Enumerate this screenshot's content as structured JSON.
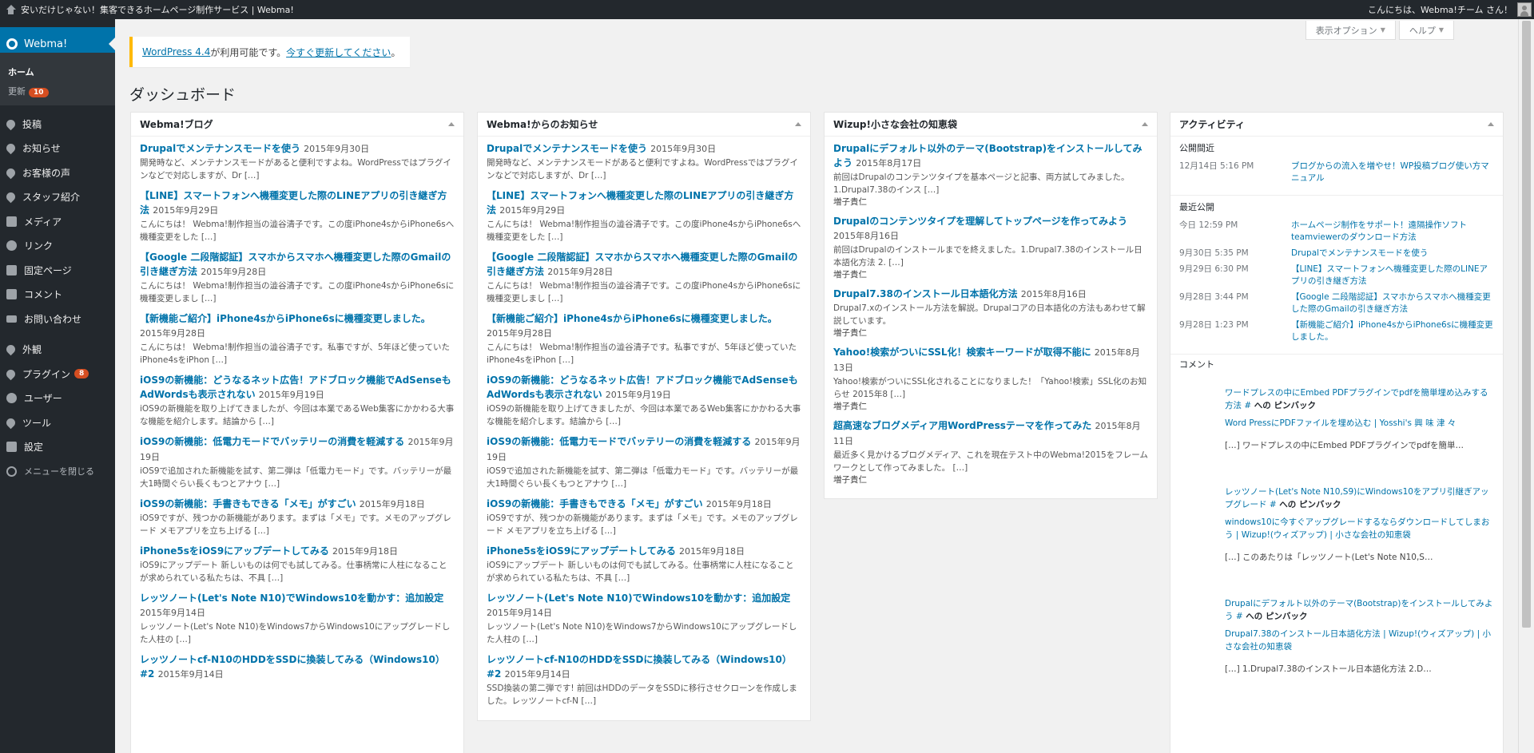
{
  "adminbar": {
    "site_title": "安いだけじゃない！集客できるホームページ制作サービス | Webma!",
    "greeting": "こんにちは、Webma!チーム さん！"
  },
  "sidebar": {
    "brand": "Webma!",
    "home": "ホーム",
    "updates": "更新",
    "updates_count": "10",
    "items": [
      {
        "label": "投稿",
        "icon": "pin-icon"
      },
      {
        "label": "お知らせ",
        "icon": "pin-icon"
      },
      {
        "label": "お客様の声",
        "icon": "pin-icon"
      },
      {
        "label": "スタッフ紹介",
        "icon": "pin-icon"
      },
      {
        "label": "メディア",
        "icon": "media-icon"
      },
      {
        "label": "リンク",
        "icon": "link-icon"
      },
      {
        "label": "固定ページ",
        "icon": "page-icon"
      },
      {
        "label": "コメント",
        "icon": "comment-icon"
      },
      {
        "label": "お問い合わせ",
        "icon": "envelope-icon"
      },
      {
        "label": "外観",
        "icon": "brush-icon"
      },
      {
        "label": "プラグイン",
        "icon": "plugin-icon",
        "badge": "8"
      },
      {
        "label": "ユーザー",
        "icon": "user-icon"
      },
      {
        "label": "ツール",
        "icon": "wrench-icon"
      },
      {
        "label": "設定",
        "icon": "settings-icon"
      }
    ],
    "collapse": "メニューを閉じる"
  },
  "screen_tabs": {
    "options": "表示オプション",
    "help": "ヘルプ"
  },
  "notice": {
    "link1": "WordPress 4.4",
    "text": " が利用可能です。",
    "link2": "今すぐ更新してください",
    "end": "。"
  },
  "page_title": "ダッシュボード",
  "col1": {
    "title": "Webma!ブログ",
    "posts": [
      {
        "title": "Drupalでメンテナンスモードを使う",
        "date": "2015年9月30日",
        "excerpt": "開発時など、メンテナンスモードがあると便利ですよね。WordPressではプラグインなどで対応しますが、Dr […]"
      },
      {
        "title": "【LINE】スマートフォンへ機種変更した際のLINEアプリの引き継ぎ方法",
        "date": "2015年9月29日",
        "excerpt": "こんにちは！ Webma!制作担当の澁谷清子です。この度iPhone4sからiPhone6sへ機種変更をした […]"
      },
      {
        "title": "【Google 二段階認証】スマホからスマホへ機種変更した際のGmailの引き継ぎ方法",
        "date": "2015年9月28日",
        "excerpt": "こんにちは！ Webma!制作担当の澁谷清子です。この度iPhone4sからiPhone6sに機種変更しまし […]"
      },
      {
        "title": "【新機能ご紹介】iPhone4sからiPhone6sに機種変更しました。",
        "date": "2015年9月28日",
        "excerpt": "こんにちは！ Webma!制作担当の澁谷清子です。私事ですが、5年ほど使っていたiPhone4sをiPhon […]"
      },
      {
        "title": "iOS9の新機能：どうなるネット広告！アドブロック機能でAdSenseもAdWordsも表示されない",
        "date": "2015年9月19日",
        "excerpt": "iOS9の新機能を取り上げてきましたが、今回は本業であるWeb集客にかかわる大事な機能を紹介します。結論から […]"
      },
      {
        "title": "iOS9の新機能：低電力モードでバッテリーの消費を軽減する",
        "date": "2015年9月19日",
        "excerpt": "iOS9で追加された新機能を試す、第二弾は「低電力モード」です。バッテリーが最大1時間ぐらい長くもつとアナウ […]"
      },
      {
        "title": "iOS9の新機能：手書きもできる「メモ」がすごい",
        "date": "2015年9月18日",
        "excerpt": "iOS9ですが、残つかの新機能があります。まずは「メモ」です。メモのアップグレード メモアプリを立ち上げる […]"
      },
      {
        "title": "iPhone5sをiOS9にアップデートしてみる",
        "date": "2015年9月18日",
        "excerpt": "iOS9にアップデート 新しいものは何でも試してみる。仕事柄常に人柱になることが求められている私たちは、不具 […]"
      },
      {
        "title": "レッツノート(Let's Note N10)でWindows10を動かす：追加設定",
        "date": "2015年9月14日",
        "excerpt": "レッツノート(Let's Note N10)をWindows7からWindows10にアップグレードした人柱の […]"
      },
      {
        "title": "レッツノートcf-N10のHDDをSSDに換装してみる（Windows10）#2",
        "date": "2015年9月14日",
        "excerpt": ""
      }
    ]
  },
  "col2": {
    "title": "Webma!からのお知らせ",
    "posts": [
      {
        "title": "Drupalでメンテナンスモードを使う",
        "date": "2015年9月30日",
        "excerpt": "開発時など、メンテナンスモードがあると便利ですよね。WordPressではプラグインなどで対応しますが、Dr […]"
      },
      {
        "title": "【LINE】スマートフォンへ機種変更した際のLINEアプリの引き継ぎ方法",
        "date": "2015年9月29日",
        "excerpt": "こんにちは！ Webma!制作担当の澁谷清子です。この度iPhone4sからiPhone6sへ機種変更をした […]"
      },
      {
        "title": "【Google 二段階認証】スマホからスマホへ機種変更した際のGmailの引き継ぎ方法",
        "date": "2015年9月28日",
        "excerpt": "こんにちは！ Webma!制作担当の澁谷清子です。この度iPhone4sからiPhone6sに機種変更しまし […]"
      },
      {
        "title": "【新機能ご紹介】iPhone4sからiPhone6sに機種変更しました。",
        "date": "2015年9月28日",
        "excerpt": "こんにちは！ Webma!制作担当の澁谷清子です。私事ですが、5年ほど使っていたiPhone4sをiPhon […]"
      },
      {
        "title": "iOS9の新機能：どうなるネット広告！アドブロック機能でAdSenseもAdWordsも表示されない",
        "date": "2015年9月19日",
        "excerpt": "iOS9の新機能を取り上げてきましたが、今回は本業であるWeb集客にかかわる大事な機能を紹介します。結論から […]"
      },
      {
        "title": "iOS9の新機能：低電力モードでバッテリーの消費を軽減する",
        "date": "2015年9月19日",
        "excerpt": "iOS9で追加された新機能を試す、第二弾は「低電力モード」です。バッテリーが最大1時間ぐらい長くもつとアナウ […]"
      },
      {
        "title": "iOS9の新機能：手書きもできる「メモ」がすごい",
        "date": "2015年9月18日",
        "excerpt": "iOS9ですが、残つかの新機能があります。まずは「メモ」です。メモのアップグレード メモアプリを立ち上げる […]"
      },
      {
        "title": "iPhone5sをiOS9にアップデートしてみる",
        "date": "2015年9月18日",
        "excerpt": "iOS9にアップデート 新しいものは何でも試してみる。仕事柄常に人柱になることが求められている私たちは、不具 […]"
      },
      {
        "title": "レッツノート(Let's Note N10)でWindows10を動かす：追加設定",
        "date": "2015年9月14日",
        "excerpt": "レッツノート(Let's Note N10)をWindows7からWindows10にアップグレードした人柱の […]"
      },
      {
        "title": "レッツノートcf-N10のHDDをSSDに換装してみる（Windows10）#2",
        "date": "2015年9月14日",
        "excerpt": "SSD換装の第二弾です! 前回はHDDのデータをSSDに移行させクローンを作成しました。レッツノートcf-N […]"
      }
    ]
  },
  "col3": {
    "title": "Wizup!小さな会社の知恵袋",
    "posts": [
      {
        "title": "Drupalにデフォルト以外のテーマ(Bootstrap)をインストールしてみよう",
        "date": "2015年8月17日",
        "excerpt": "前回はDrupalのコンテンツタイプを基本ページと記事、両方試してみました。1.Drupal7.38のインス […]",
        "author": "増子貴仁"
      },
      {
        "title": "Drupalのコンテンツタイプを理解してトップページを作ってみよう",
        "date": "2015年8月16日",
        "excerpt": "前回はDrupalのインストールまでを終えました。1.Drupal7.38のインストール日本語化方法 2. […]",
        "author": "増子貴仁"
      },
      {
        "title": "Drupal7.38のインストール日本語化方法",
        "date": "2015年8月16日",
        "excerpt": "Drupal7.xのインストール方法を解説。Drupalコアの日本語化の方法もあわせて解説しています。",
        "author": "増子貴仁"
      },
      {
        "title": "Yahoo!検索がついにSSL化！検索キーワードが取得不能に",
        "date": "2015年8月13日",
        "excerpt": "Yahoo!検索がついにSSL化されることになりました！「Yahoo!検索」SSL化のお知らせ 2015年8 […]",
        "author": "増子貴仁"
      },
      {
        "title": "超高速なブログメディア用WordPressテーマを作ってみた",
        "date": "2015年8月11日",
        "excerpt": "最近多く見かけるブログメディア、これを現在テスト中のWebma!2015をフレームワークとして作ってみました。 […]",
        "author": "増子貴仁"
      }
    ]
  },
  "activity": {
    "title": "アクティビティ",
    "scheduled_heading": "公開間近",
    "scheduled": [
      {
        "when": "12月14日 5:16 PM",
        "title": "ブログからの流入を増やせ！WP投稿ブログ使い方マニュアル"
      }
    ],
    "recent_heading": "最近公開",
    "recent": [
      {
        "when": "今日 12:59 PM",
        "title": "ホームページ制作をサポート！遠隔操作ソフトteamviewerのダウンロード方法"
      },
      {
        "when": "9月30日 5:35 PM",
        "title": "Drupalでメンテナンスモードを使う"
      },
      {
        "when": "9月29日 6:30 PM",
        "title": "【LINE】スマートフォンへ機種変更した際のLINEアプリの引き継ぎ方法"
      },
      {
        "when": "9月28日 3:44 PM",
        "title": "【Google 二段階認証】スマホからスマホへ機種変更した際のGmailの引き継ぎ方法"
      },
      {
        "when": "9月28日 1:23 PM",
        "title": "【新機能ご紹介】iPhone4sからiPhone6sに機種変更しました。"
      }
    ],
    "comments_heading": "コメント",
    "comments": [
      {
        "target": "ワードプレスの中にEmbed PDFプラグインでpdfを簡単埋め込みする方法 #",
        "kind": " への ピンバック",
        "link": "Word PressにPDFファイルを埋め込む | Yosshi's 興 味 津 々",
        "excerpt": "[…] ワードプレスの中にEmbed PDFプラグインでpdfを簡単…"
      },
      {
        "target": "レッツノート(Let's Note N10,S9)にWindows10をアプリ引継ぎアップグレード #",
        "kind": " への ピンバック",
        "link": "windows10に今すぐアップグレードするならダウンロードしてしまおう | Wizup!(ウィズアップ) | 小さな会社の知恵袋",
        "excerpt": "[…] このあたりは「レッツノート(Let's Note N10,S…"
      },
      {
        "target": "Drupalにデフォルト以外のテーマ(Bootstrap)をインストールしてみよう #",
        "kind": " への ピンバック",
        "link": "Drupal7.38のインストール日本語化方法 | Wizup!(ウィズアップ) | 小さな会社の知恵袋",
        "excerpt": "[…] 1.Drupal7.38のインストール日本語化方法 2.D…"
      }
    ]
  }
}
